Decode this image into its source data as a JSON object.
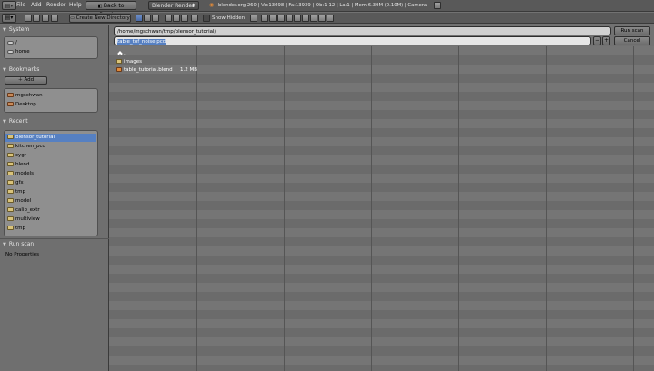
{
  "header": {
    "menus": [
      "File",
      "Add",
      "Render",
      "Help"
    ],
    "back_label": "Back to Previous",
    "render_engine": "Blender Render",
    "status_text": "blender.org 260 | Ve:13698 | Fa:13939 | Ob:1-12 | La:1 | Mem:6.39M (0.10M) | Camera"
  },
  "toolbar": {
    "create_dir_label": "Create New Directory",
    "show_hidden_label": "Show Hidden"
  },
  "sidebar": {
    "system": {
      "title": "System",
      "items": [
        "/",
        "home"
      ]
    },
    "bookmarks": {
      "title": "Bookmarks",
      "add_label": "Add",
      "items": [
        "mgschwan",
        "Desktop"
      ]
    },
    "recent": {
      "title": "Recent",
      "items": [
        "blensor_tutorial",
        "kitchen_pcd",
        "cygr",
        "blend",
        "models",
        "gfx",
        "tmp",
        "model",
        "calib_extr",
        "multiview",
        "tmp"
      ],
      "selected_index": 0
    },
    "run_scan": {
      "title": "Run scan",
      "no_properties": "No Properties"
    }
  },
  "pathbar": {
    "directory": "/home/mgschwan/tmp/blensor_tutorial/",
    "filename": "table_tof_noise.pcd",
    "run_button": "Run scan",
    "cancel_button": "Cancel"
  },
  "files": [
    {
      "name": "..",
      "type": "up",
      "size": ""
    },
    {
      "name": "images",
      "type": "folder",
      "size": ""
    },
    {
      "name": "table_tutorial.blend",
      "type": "blend",
      "size": "1.2 MB"
    }
  ],
  "colors": {
    "selection": "#5680c2",
    "panel_bg": "#6f6f6f",
    "header_bg": "#595959"
  }
}
